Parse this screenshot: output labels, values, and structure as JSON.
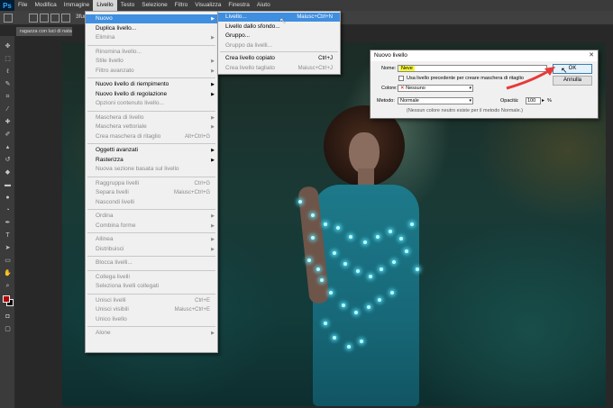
{
  "app": {
    "logo": "Ps"
  },
  "menubar": {
    "items": [
      "File",
      "Modifica",
      "Immagine",
      "Livello",
      "Testo",
      "Selezione",
      "Filtro",
      "Visualizza",
      "Finestra",
      "Aiuto"
    ],
    "active_index": 3
  },
  "options_bar": {
    "size_label": "3fum"
  },
  "document": {
    "tab_title": "ragazza con luci di natale.jpg"
  },
  "livello_menu": {
    "items": [
      {
        "label": "Nuovo",
        "state": "highlighted",
        "submenu": true
      },
      {
        "label": "Duplica livello...",
        "state": "enabled"
      },
      {
        "label": "Elimina",
        "state": "disabled",
        "submenu": true
      },
      {
        "label": "Rinomina livello...",
        "state": "disabled"
      },
      {
        "label": "Stile livello",
        "state": "disabled",
        "submenu": true
      },
      {
        "label": "Filtro avanzato",
        "state": "disabled",
        "submenu": true
      },
      {
        "label": "Nuovo livello di riempimento",
        "state": "enabled",
        "submenu": true
      },
      {
        "label": "Nuovo livello di regolazione",
        "state": "enabled",
        "submenu": true
      },
      {
        "label": "Opzioni contenuto livello...",
        "state": "disabled"
      },
      {
        "label": "Maschera di livello",
        "state": "disabled",
        "submenu": true
      },
      {
        "label": "Maschera vettoriale",
        "state": "disabled",
        "submenu": true
      },
      {
        "label": "Crea maschera di ritaglio",
        "state": "disabled",
        "shortcut": "Alt+Ctrl+G"
      },
      {
        "label": "Oggetti avanzati",
        "state": "enabled",
        "submenu": true
      },
      {
        "label": "Rasterizza",
        "state": "enabled",
        "submenu": true
      },
      {
        "label": "Nuova sezione basata sul livello",
        "state": "disabled"
      },
      {
        "label": "Raggruppa livelli",
        "state": "disabled",
        "shortcut": "Ctrl+G"
      },
      {
        "label": "Separa livelli",
        "state": "disabled",
        "shortcut": "Maiusc+Ctrl+G"
      },
      {
        "label": "Nascondi livelli",
        "state": "disabled"
      },
      {
        "label": "Ordina",
        "state": "disabled",
        "submenu": true
      },
      {
        "label": "Combina forme",
        "state": "disabled",
        "submenu": true
      },
      {
        "label": "Allinea",
        "state": "disabled",
        "submenu": true
      },
      {
        "label": "Distribuisci",
        "state": "disabled",
        "submenu": true
      },
      {
        "label": "Blocca livelli...",
        "state": "disabled"
      },
      {
        "label": "Collega livelli",
        "state": "disabled"
      },
      {
        "label": "Seleziona livelli collegati",
        "state": "disabled"
      },
      {
        "label": "Unisci livelli",
        "state": "disabled",
        "shortcut": "Ctrl+E"
      },
      {
        "label": "Unisci visibili",
        "state": "disabled",
        "shortcut": "Maiusc+Ctrl+E"
      },
      {
        "label": "Unico livello",
        "state": "disabled"
      },
      {
        "label": "Alone",
        "state": "disabled",
        "submenu": true
      }
    ]
  },
  "nuovo_submenu": {
    "items": [
      {
        "label": "Livello...",
        "state": "highlighted",
        "shortcut": "Maiusc+Ctrl+N"
      },
      {
        "label": "Livello dallo sfondo...",
        "state": "enabled"
      },
      {
        "label": "Gruppo...",
        "state": "enabled"
      },
      {
        "label": "Gruppo da livelli...",
        "state": "disabled"
      },
      {
        "label": "Crea livello copiato",
        "state": "enabled",
        "shortcut": "Ctrl+J"
      },
      {
        "label": "Crea livello tagliato",
        "state": "disabled",
        "shortcut": "Maiusc+Ctrl+J"
      }
    ]
  },
  "dialog": {
    "title": "Nuovo livello",
    "close_glyph": "✕",
    "name_label": "Nome:",
    "name_value": "Neve",
    "clip_checkbox_label": "Usa livello precedente per creare maschera di ritaglio",
    "colore_label": "Colore:",
    "colore_value": "Nessuno",
    "colore_swatch": "✕",
    "metodo_label": "Metodo:",
    "metodo_value": "Normale",
    "opacita_label": "Opacità:",
    "opacita_value": "100",
    "opacita_unit": "%",
    "neutral_note": "(Nessun colore neutro esiste per il metodo Normale.)",
    "ok_label": "OK",
    "annulla_label": "Annulla",
    "arrow_color": "#e83a3a"
  },
  "toolbar": {
    "tools": [
      "move-tool-icon",
      "marquee-tool-icon",
      "lasso-tool-icon",
      "quick-select-tool-icon",
      "crop-tool-icon",
      "eyedropper-tool-icon",
      "healing-tool-icon",
      "brush-tool-icon",
      "stamp-tool-icon",
      "history-brush-tool-icon",
      "eraser-tool-icon",
      "gradient-tool-icon",
      "blur-tool-icon",
      "dodge-tool-icon",
      "pen-tool-icon",
      "type-tool-icon",
      "path-select-tool-icon",
      "shape-tool-icon",
      "hand-tool-icon",
      "zoom-tool-icon"
    ],
    "fg_color": "#b30000",
    "bg_color": "#000000"
  }
}
